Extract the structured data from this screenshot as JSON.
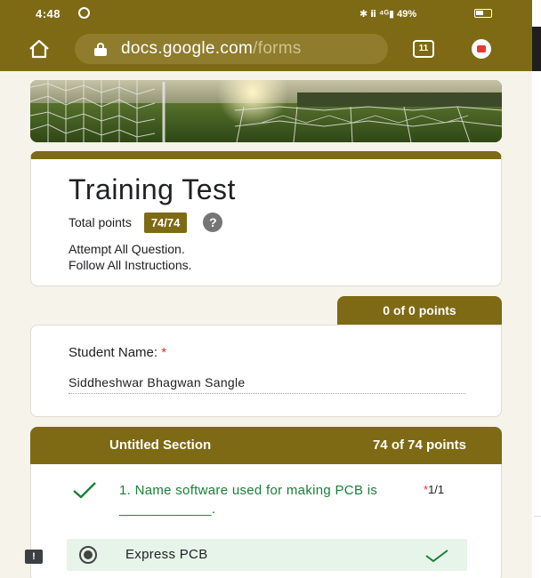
{
  "status_bar": {
    "time": "4:48",
    "system_icons": "✱ ⅱ ⁴ᴳ▮ 49%"
  },
  "browser": {
    "url_domain": "docs.google.com",
    "url_path": "/forms",
    "tab_count": "11",
    "accent_color": "#7e6a14"
  },
  "form": {
    "title": "Training Test",
    "total_points_label": "Total points",
    "total_points_value": "74/74",
    "help_icon": "?",
    "description_line1": "Attempt All Question.",
    "description_line2": "Follow All Instructions."
  },
  "student_question": {
    "points": "0 of 0 points",
    "label": "Student Name:",
    "required_mark": "*",
    "answer": "Siddheshwar Bhagwan Sangle"
  },
  "section": {
    "title": "Untitled Section",
    "points": "74 of 74 points",
    "question": {
      "text": "1. Name software used for making PCB is ____________.",
      "required_mark": "*",
      "score": "1/1",
      "selected_option": "Express PCB",
      "correct_color": "#188038"
    }
  },
  "feedback_icon": "!"
}
